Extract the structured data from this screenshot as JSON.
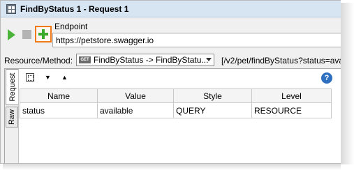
{
  "window": {
    "title": "FindByStatus 1 - Request 1",
    "app_icon": "soapui-icon"
  },
  "toolbar": {
    "run_icon": "play-icon",
    "stop_icon": "stop-icon",
    "add_icon": "plus-icon",
    "endpoint_label": "Endpoint",
    "endpoint_value": "https://petstore.swagger.io"
  },
  "resource": {
    "label": "Resource/Method:",
    "method_badge": "GET",
    "selected": "FindByStatus -> FindByStatu...",
    "path": "[/v2/pet/findByStatus?status=ava"
  },
  "side_tabs": [
    "Request",
    "Raw"
  ],
  "params": {
    "columns": [
      "Name",
      "Value",
      "Style",
      "Level"
    ],
    "rows": [
      [
        "status",
        "available",
        "QUERY",
        "RESOURCE"
      ]
    ]
  },
  "colors": {
    "accent": "#f07a18",
    "play": "#4bb33a",
    "help": "#2f6fc0"
  }
}
